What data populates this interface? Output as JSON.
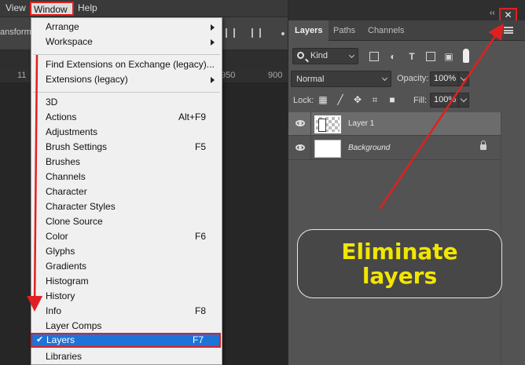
{
  "menubar": {
    "view": "View",
    "window": "Window",
    "help": "Help"
  },
  "options_bar": {
    "transform_text": "ansform C"
  },
  "ruler": {
    "labels": [
      "11",
      "950",
      "900"
    ]
  },
  "window_menu": {
    "items": [
      {
        "label": "Arrange",
        "submenu": true
      },
      {
        "label": "Workspace",
        "submenu": true
      },
      {
        "label": "Find Extensions on Exchange (legacy)..."
      },
      {
        "label": "Extensions (legacy)",
        "submenu": true
      },
      {
        "label": "3D"
      },
      {
        "label": "Actions",
        "shortcut": "Alt+F9"
      },
      {
        "label": "Adjustments"
      },
      {
        "label": "Brush Settings",
        "shortcut": "F5"
      },
      {
        "label": "Brushes"
      },
      {
        "label": "Channels"
      },
      {
        "label": "Character"
      },
      {
        "label": "Character Styles"
      },
      {
        "label": "Clone Source"
      },
      {
        "label": "Color",
        "shortcut": "F6"
      },
      {
        "label": "Glyphs"
      },
      {
        "label": "Gradients"
      },
      {
        "label": "Histogram"
      },
      {
        "label": "History"
      },
      {
        "label": "Info",
        "shortcut": "F8"
      },
      {
        "label": "Layer Comps"
      },
      {
        "label": "Layers",
        "shortcut": "F7",
        "checked": true,
        "check_glyph": "✔"
      },
      {
        "label": "Libraries"
      }
    ]
  },
  "panel": {
    "collapse_glyph": "‹‹",
    "close_glyph": "✕",
    "tabs": [
      "Layers",
      "Paths",
      "Channels"
    ],
    "active_tab": "Layers",
    "filter": {
      "kind_label": "Kind"
    },
    "blend_mode": "Normal",
    "opacity": {
      "label": "Opacity:",
      "value": "100%"
    },
    "lock": {
      "label": "Lock:"
    },
    "fill": {
      "label": "Fill:",
      "value": "100%"
    },
    "layers": [
      {
        "name": "Layer 1",
        "selected": true
      },
      {
        "name": "Background",
        "locked": true
      }
    ]
  },
  "annotation": {
    "line1": "Eliminate",
    "line2": "layers"
  },
  "colors": {
    "accent_red": "#e02020",
    "selection_blue": "#1e73d8",
    "callout_text": "#f2e600"
  }
}
